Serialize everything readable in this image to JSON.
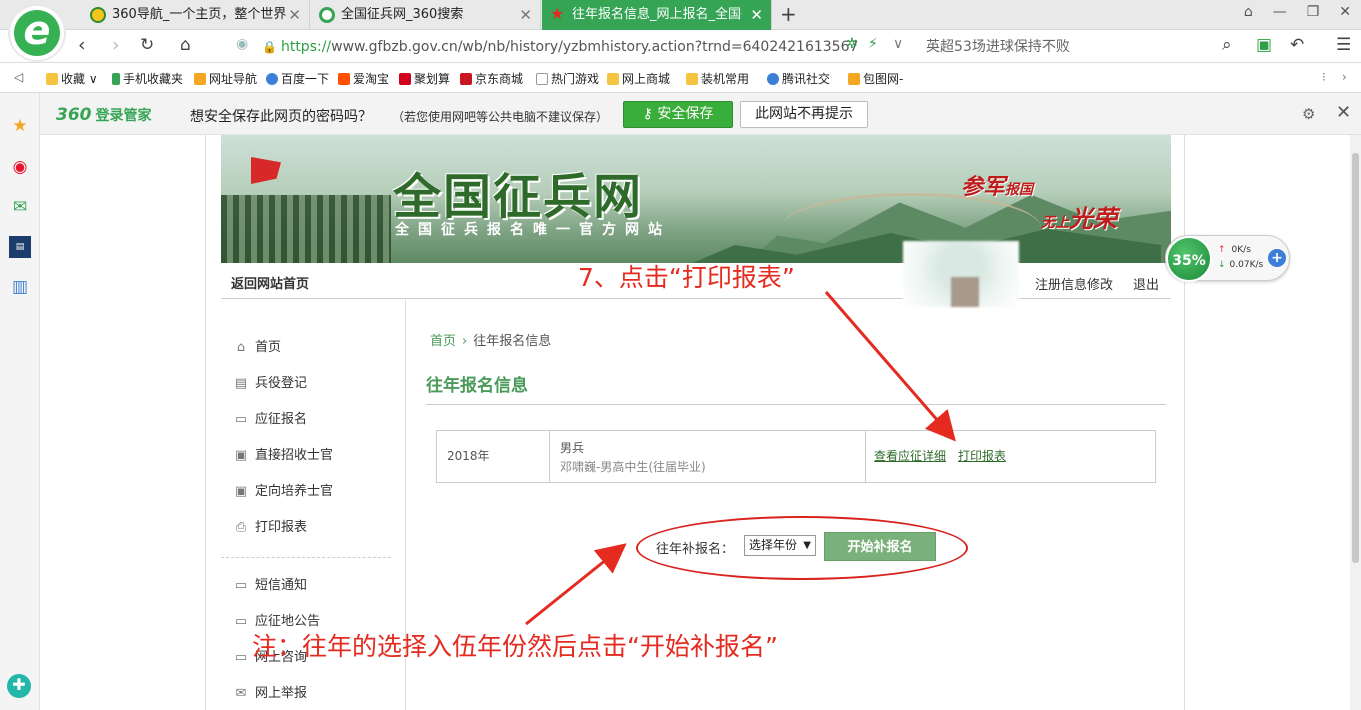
{
  "tabs": [
    {
      "label": "360导航_一个主页，整个世界",
      "icon": "yellow-circle-icon",
      "active": false
    },
    {
      "label": "全国征兵网_360搜索",
      "icon": "search-circle-icon",
      "active": false
    },
    {
      "label": "往年报名信息_网上报名_全国征兵网",
      "icon": "star-icon",
      "active": true
    }
  ],
  "address": {
    "url_scheme": "https://",
    "url_rest": "www.gfbzb.gov.cn/wb/nb/history/yzbmhistory.action?trnd=6402421613567",
    "search_text": "英超53场进球保持不败"
  },
  "bookmarks": [
    {
      "label": "收藏",
      "color": "#f5c542"
    },
    {
      "label": "手机收藏夹",
      "color": "#35a555"
    },
    {
      "label": "网址导航",
      "color": "#f5a623"
    },
    {
      "label": "百度一下",
      "color": "#3b7fd8"
    },
    {
      "label": "爱淘宝",
      "color": "#ff5000"
    },
    {
      "label": "聚划算",
      "color": "#d0021b"
    },
    {
      "label": "京东商城",
      "color": "#c81623"
    },
    {
      "label": "热门游戏",
      "color": "#ffffff"
    },
    {
      "label": "网上商城",
      "color": "#f5c542"
    },
    {
      "label": "装机常用",
      "color": "#f5c542"
    },
    {
      "label": "腾讯社交",
      "color": "#3b7fd8"
    },
    {
      "label": "包图网-",
      "color": "#f5a623"
    }
  ],
  "password_bar": {
    "brand_360": "360",
    "brand_text": "登录管家",
    "prompt": "想安全保存此网页的密码吗？",
    "note": "（若您使用网吧等公共电脑不建议保存）",
    "save_label": "安全保存",
    "never_label": "此网站不再提示"
  },
  "banner": {
    "title": "全国征兵网",
    "subtitle": "全国征兵报名唯一官方网站",
    "slogan_a": "参军",
    "slogan_a_small": "报国",
    "slogan_b_small": "无上",
    "slogan_b": "光荣"
  },
  "topnav": {
    "home_label": "返回网站首页",
    "edit_label": "注册信息修改",
    "logout_label": "退出"
  },
  "menu": [
    {
      "label": "首页",
      "icon": "home-icon"
    },
    {
      "label": "兵役登记",
      "icon": "clipboard-icon"
    },
    {
      "label": "应征报名",
      "icon": "form-icon"
    },
    {
      "label": "直接招收士官",
      "icon": "id-card-icon"
    },
    {
      "label": "定向培养士官",
      "icon": "id-card-icon"
    },
    {
      "label": "打印报表",
      "icon": "printer-icon"
    },
    {
      "label": "短信通知",
      "icon": "message-icon"
    },
    {
      "label": "应征地公告",
      "icon": "message-icon"
    },
    {
      "label": "网上咨询",
      "icon": "message-icon"
    },
    {
      "label": "网上举报",
      "icon": "mail-icon"
    }
  ],
  "main": {
    "crumb_home": "首页",
    "crumb_current": "往年报名信息",
    "title": "往年报名信息",
    "record": {
      "year": "2018年",
      "type": "男兵",
      "detail": "邓啸巍-男高中生(往届毕业)",
      "view_label": "查看应征详细",
      "print_label": "打印报表"
    },
    "supplement_label": "往年补报名：",
    "supplement_select": "选择年份",
    "supplement_button": "开始补报名"
  },
  "speed_widget": {
    "percent": "35%",
    "up": "0K/s",
    "down": "0.07K/s"
  },
  "annotations": {
    "step": "7、点击“打印报表”",
    "note": "注：往年的选择入伍年份然后点击“开始补报名”",
    "color": "#e52a20"
  }
}
